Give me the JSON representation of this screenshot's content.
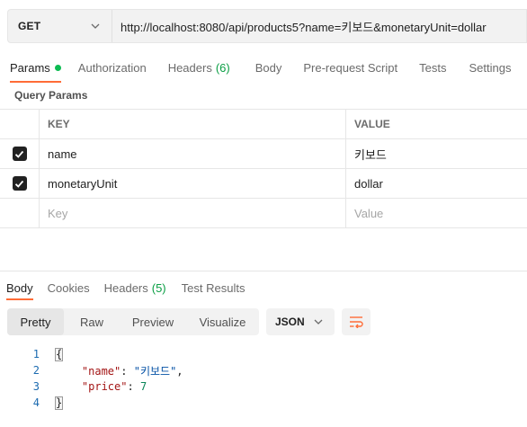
{
  "request": {
    "method": "GET",
    "url": "http://localhost:8080/api/products5?name=키보드&monetaryUnit=dollar"
  },
  "request_tabs": [
    {
      "label": "Params",
      "active": true,
      "has_dot": true
    },
    {
      "label": "Authorization"
    },
    {
      "label": "Headers",
      "count": "(6)"
    },
    {
      "label": "Body"
    },
    {
      "label": "Pre-request Script"
    },
    {
      "label": "Tests"
    },
    {
      "label": "Settings"
    }
  ],
  "query_params": {
    "title": "Query Params",
    "headers": {
      "key": "KEY",
      "value": "VALUE"
    },
    "rows": [
      {
        "checked": true,
        "key": "name",
        "value": "키보드"
      },
      {
        "checked": true,
        "key": "monetaryUnit",
        "value": "dollar"
      }
    ],
    "placeholder": {
      "key": "Key",
      "value": "Value"
    }
  },
  "response_tabs": [
    {
      "label": "Body",
      "active": true
    },
    {
      "label": "Cookies"
    },
    {
      "label": "Headers",
      "count": "(5)"
    },
    {
      "label": "Test Results"
    }
  ],
  "view_modes": [
    {
      "label": "Pretty",
      "active": true
    },
    {
      "label": "Raw"
    },
    {
      "label": "Preview"
    },
    {
      "label": "Visualize"
    }
  ],
  "format": "JSON",
  "code": {
    "line_numbers": [
      "1",
      "2",
      "3",
      "4"
    ],
    "open_brace": "{",
    "close_brace": "}",
    "name_key": "\"name\"",
    "name_value": "\"키보드\"",
    "price_key": "\"price\"",
    "price_value": "7"
  },
  "colors": {
    "accent": "#ff6c37",
    "status_green": "#0cbb52"
  },
  "icons": {
    "method_dropdown": "chevron-down-icon",
    "format_dropdown": "chevron-down-icon",
    "wrap": "wrap-lines-icon",
    "checkbox": "check-icon"
  }
}
